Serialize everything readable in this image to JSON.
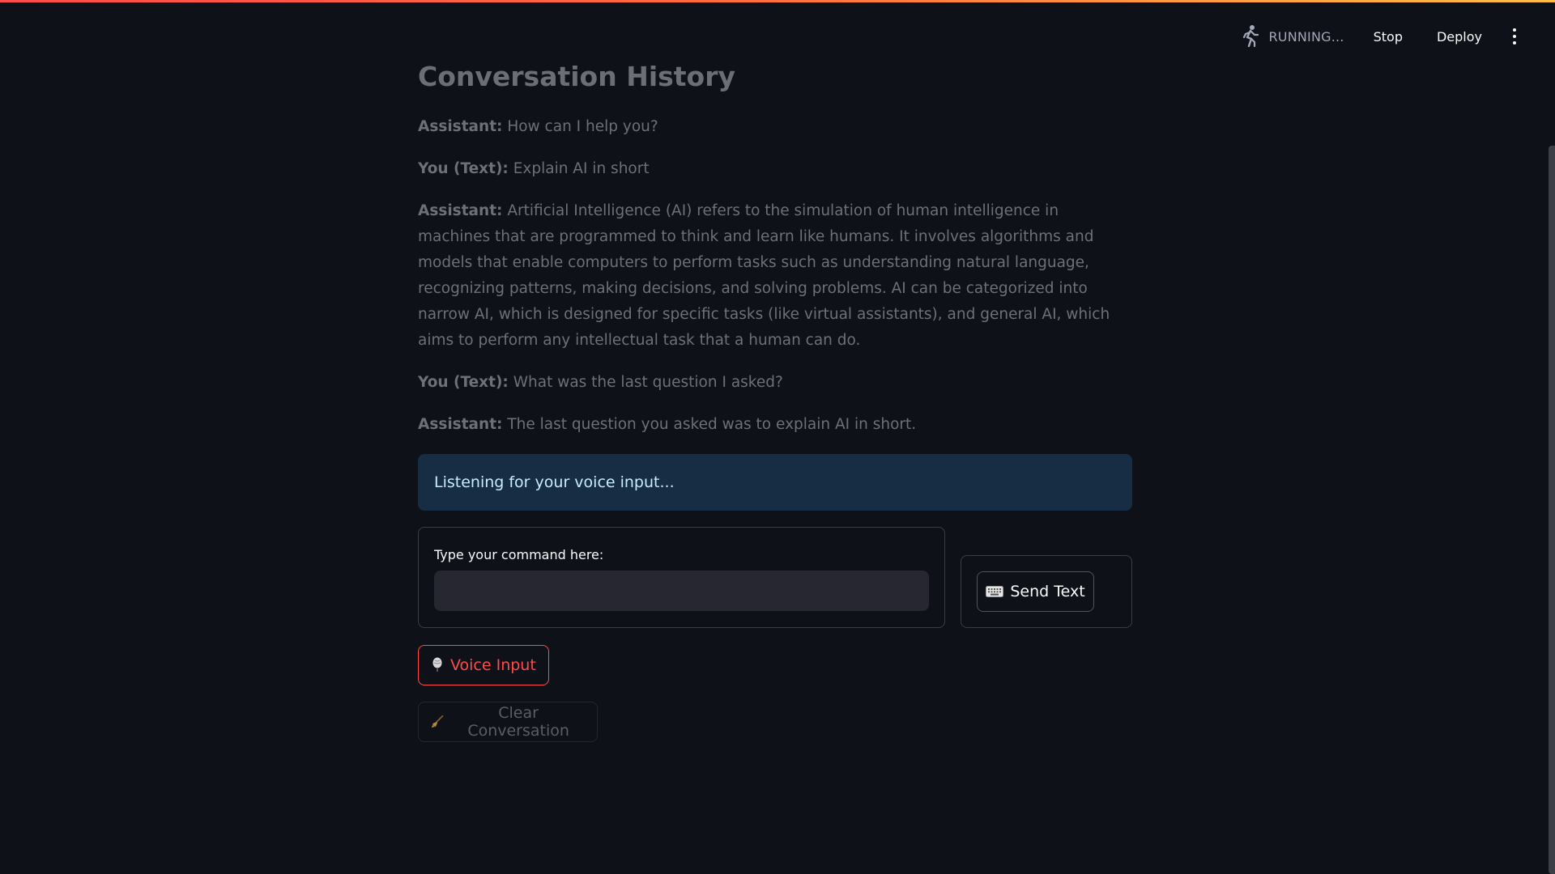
{
  "toolbar": {
    "status": "RUNNING...",
    "stop_label": "Stop",
    "deploy_label": "Deploy",
    "status_icon": "running-man-icon",
    "menu_icon": "kebab-menu-icon"
  },
  "main": {
    "title": "Conversation History",
    "messages": [
      {
        "speaker": "Assistant:",
        "text": " How can I help you?"
      },
      {
        "speaker": "You (Text):",
        "text": " Explain AI in short"
      },
      {
        "speaker": "Assistant:",
        "text": " Artificial Intelligence (AI) refers to the simulation of human intelligence in machines that are programmed to think and learn like humans. It involves algorithms and models that enable computers to perform tasks such as understanding natural language, recognizing patterns, making decisions, and solving problems. AI can be categorized into narrow AI, which is designed for specific tasks (like virtual assistants), and general AI, which aims to perform any intellectual task that a human can do."
      },
      {
        "speaker": "You (Text):",
        "text": " What was the last question I asked?"
      },
      {
        "speaker": "Assistant:",
        "text": " The last question you asked was to explain AI in short."
      }
    ],
    "info": "Listening for your voice input...",
    "input": {
      "label": "Type your command here:",
      "value": "",
      "placeholder": ""
    },
    "send_label": "Send Text",
    "voice_label": "Voice Input",
    "clear_label": "Clear Conversation"
  },
  "colors": {
    "background": "#0e1117",
    "accent": "#ff4b4b",
    "info_bg": "#172d43",
    "info_text": "#c7ebff"
  }
}
